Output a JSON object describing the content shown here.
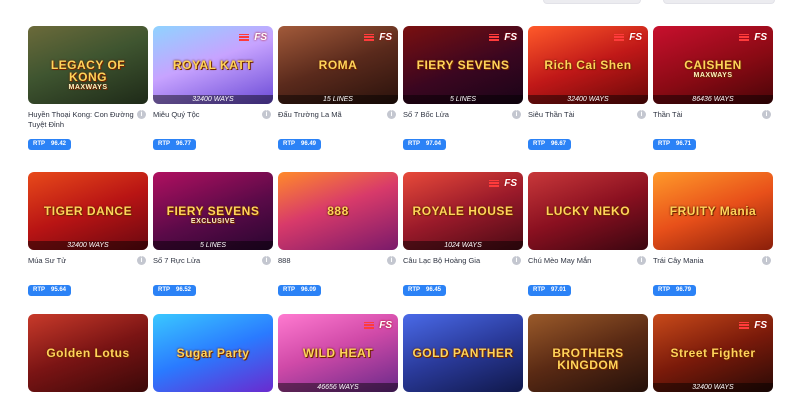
{
  "games": [
    {
      "name": "Huyền Thoại Kong: Con Đường Tuyệt Đỉnh",
      "logo": "LEGACY OF KONG",
      "sub": "MAXWAYS",
      "ways": "",
      "fs": false,
      "rtp": "96.42",
      "bg": "linear-gradient(160deg,#6b6a3a 0%,#3f5530 45%,#1e2a18 100%)"
    },
    {
      "name": "Miêu Quý Tộc",
      "logo": "ROYAL KATT",
      "sub": "",
      "ways": "32400 WAYS",
      "fs": true,
      "rtp": "96.77",
      "bg": "linear-gradient(160deg,#8fd3ff 0%,#c7a3ff 45%,#6b4bd6 100%)"
    },
    {
      "name": "Đấu Trường La Mã",
      "logo": "ROMA",
      "sub": "",
      "ways": "15 LINES",
      "fs": true,
      "rtp": "96.49",
      "bg": "linear-gradient(160deg,#a25a3a 0%,#5a2a1c 50%,#2a120c 100%)"
    },
    {
      "name": "Số 7 Bốc Lửa",
      "logo": "FIERY SEVENS",
      "sub": "",
      "ways": "5 LINES",
      "fs": true,
      "rtp": "97.04",
      "bg": "linear-gradient(160deg,#7a1010 0%,#3a0620 55%,#1a0418 100%)"
    },
    {
      "name": "Siêu Thần Tài",
      "logo": "Rich Cai Shen",
      "sub": "",
      "ways": "32400 WAYS",
      "fs": true,
      "rtp": "96.67",
      "bg": "linear-gradient(160deg,#ff5a2a 0%,#c01818 50%,#6a0808 100%)"
    },
    {
      "name": "Thần Tài",
      "logo": "CAISHEN",
      "sub": "MAXWAYS",
      "ways": "86436 WAYS",
      "fs": true,
      "rtp": "96.71",
      "bg": "linear-gradient(160deg,#c8102e 0%,#8a0a14 55%,#4a0508 100%)"
    },
    {
      "name": "Múa Sư Tử",
      "logo": "TIGER DANCE",
      "sub": "",
      "ways": "32400 WAYS",
      "fs": false,
      "rtp": "95.64",
      "bg": "linear-gradient(160deg,#e84a1a 0%,#b81414 50%,#6a0810 100%)"
    },
    {
      "name": "Số 7 Rực Lửa",
      "logo": "FIERY SEVENS",
      "sub": "EXCLUSIVE",
      "ways": "5 LINES",
      "fs": false,
      "rtp": "96.52",
      "bg": "linear-gradient(160deg,#b01060 0%,#5a0a48 55%,#2a0630 100%)"
    },
    {
      "name": "888",
      "logo": "888",
      "sub": "",
      "ways": "",
      "fs": false,
      "rtp": "96.09",
      "bg": "linear-gradient(160deg,#ff8a2a 0%,#d83a6a 45%,#7a1a6a 100%)"
    },
    {
      "name": "Câu Lạc Bộ Hoàng Gia",
      "logo": "ROYALE HOUSE",
      "sub": "",
      "ways": "1024 WAYS",
      "fs": true,
      "rtp": "96.45",
      "bg": "linear-gradient(160deg,#e84a3a 0%,#9a1a2a 50%,#4a0a14 100%)"
    },
    {
      "name": "Chú Mèo May Mắn",
      "logo": "LUCKY NEKO",
      "sub": "",
      "ways": "",
      "fs": false,
      "rtp": "97.01",
      "bg": "linear-gradient(160deg,#c8383a 0%,#8a1020 50%,#3a0610 100%)"
    },
    {
      "name": "Trái Cây Mania",
      "logo": "FRUITY Mania",
      "sub": "",
      "ways": "",
      "fs": false,
      "rtp": "96.79",
      "bg": "linear-gradient(160deg,#ff9a2a 0%,#e8501a 50%,#8a1e0a 100%)"
    },
    {
      "name": "",
      "logo": "Golden Lotus",
      "sub": "",
      "ways": "",
      "fs": false,
      "rtp": "",
      "bg": "linear-gradient(160deg,#c83a2a 0%,#7a1414 50%,#3a0808 100%)"
    },
    {
      "name": "",
      "logo": "Sugar Party",
      "sub": "",
      "ways": "",
      "fs": false,
      "rtp": "",
      "bg": "linear-gradient(160deg,#3ac8ff 0%,#2a7aff 50%,#6a2acf 100%)"
    },
    {
      "name": "",
      "logo": "WILD HEAT",
      "sub": "",
      "ways": "46656 WAYS",
      "fs": true,
      "rtp": "",
      "bg": "linear-gradient(160deg,#ff7ad0 0%,#d04aa8 45%,#6a2a8a 100%)"
    },
    {
      "name": "",
      "logo": "GOLD PANTHER",
      "sub": "",
      "ways": "",
      "fs": false,
      "rtp": "",
      "bg": "linear-gradient(160deg,#4a6ae8 0%,#2a3a9a 50%,#10184a 100%)"
    },
    {
      "name": "",
      "logo": "BROTHERS KINGDOM",
      "sub": "",
      "ways": "",
      "fs": false,
      "rtp": "",
      "bg": "linear-gradient(160deg,#9a5a2a 0%,#5a2a14 50%,#24100a 100%)"
    },
    {
      "name": "",
      "logo": "Street Fighter",
      "sub": "",
      "ways": "32400 WAYS",
      "fs": true,
      "rtp": "",
      "bg": "linear-gradient(160deg,#c84a1a 0%,#7a1a0a 50%,#2a0a06 100%)"
    }
  ],
  "labels": {
    "rtp": "RTP",
    "fs": "FS",
    "info": "i"
  }
}
